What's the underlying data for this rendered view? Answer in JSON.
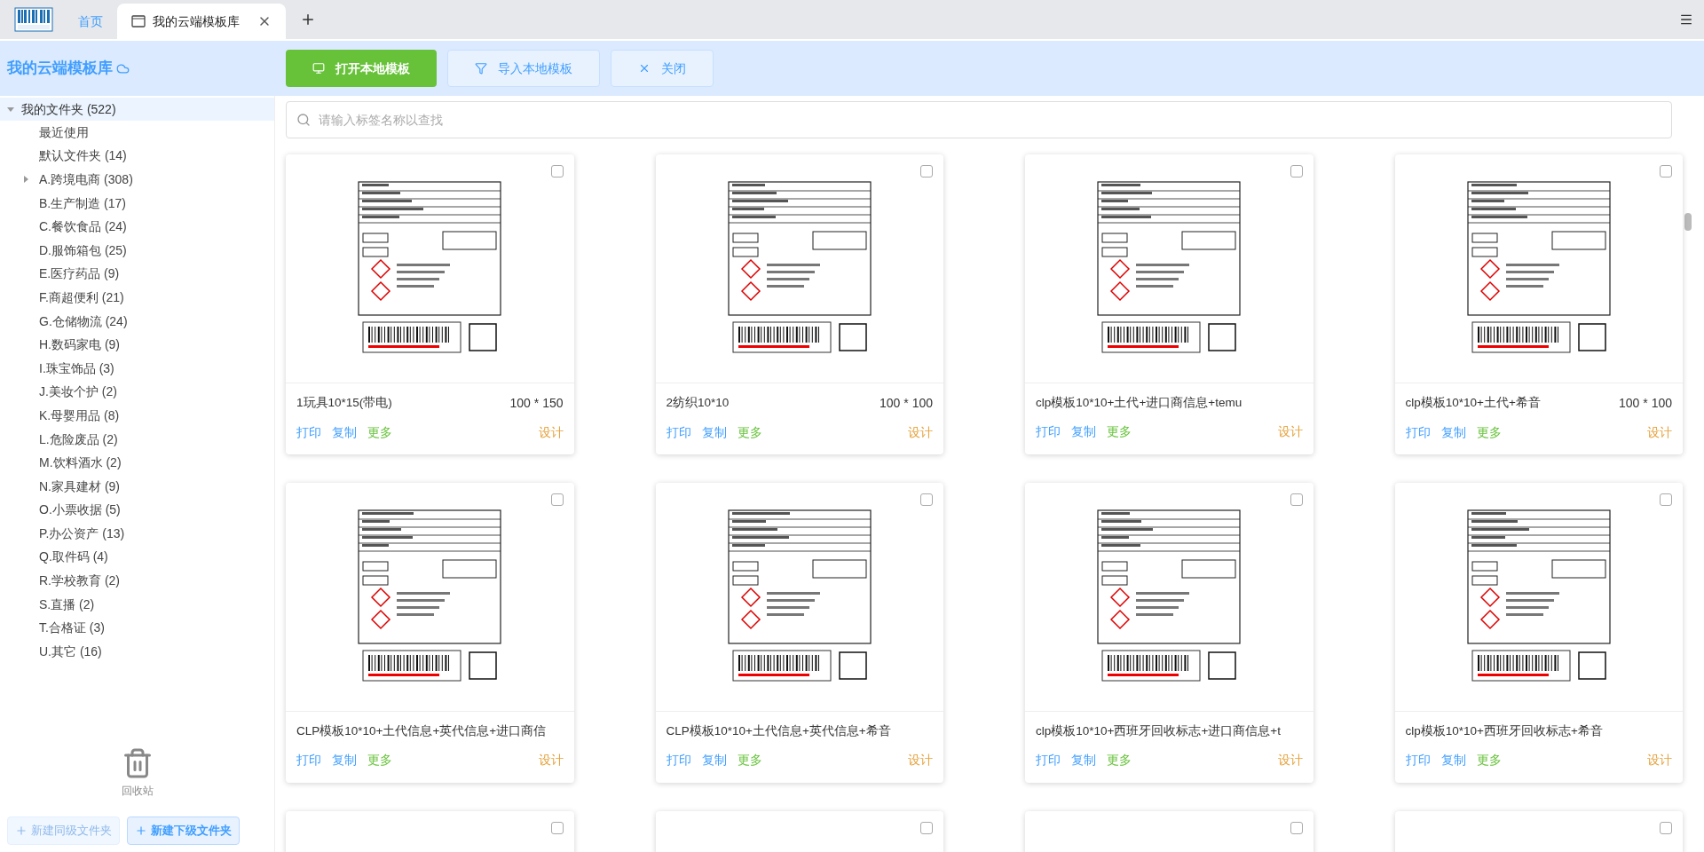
{
  "tabs": [
    {
      "label": "首页",
      "selected": false,
      "closable": false
    },
    {
      "label": "我的云端模板库",
      "selected": true,
      "closable": true
    }
  ],
  "sidebar": {
    "title": "我的云端模板库",
    "tree": {
      "label": "我的文件夹 (522)",
      "selected": true,
      "expanded": true,
      "children": [
        {
          "label": "最近使用",
          "selected": false,
          "kind": "leaf"
        },
        {
          "label": "默认文件夹 (14)",
          "selected": false,
          "kind": "leaf"
        },
        {
          "label": "A.跨境电商 (308)",
          "selected": false,
          "kind": "collapsed"
        },
        {
          "label": "B.生产制造 (17)",
          "selected": false,
          "kind": "leaf"
        },
        {
          "label": "C.餐饮食品 (24)",
          "selected": false,
          "kind": "leaf"
        },
        {
          "label": "D.服饰箱包 (25)",
          "selected": false,
          "kind": "leaf"
        },
        {
          "label": "E.医疗药品 (9)",
          "selected": false,
          "kind": "leaf"
        },
        {
          "label": "F.商超便利 (21)",
          "selected": false,
          "kind": "leaf"
        },
        {
          "label": "G.仓储物流 (24)",
          "selected": false,
          "kind": "leaf"
        },
        {
          "label": "H.数码家电 (9)",
          "selected": false,
          "kind": "leaf"
        },
        {
          "label": "I.珠宝饰品 (3)",
          "selected": false,
          "kind": "leaf"
        },
        {
          "label": "J.美妆个护 (2)",
          "selected": false,
          "kind": "leaf"
        },
        {
          "label": "K.母婴用品 (8)",
          "selected": false,
          "kind": "leaf"
        },
        {
          "label": "L.危险废品 (2)",
          "selected": false,
          "kind": "leaf"
        },
        {
          "label": "M.饮料酒水 (2)",
          "selected": false,
          "kind": "leaf"
        },
        {
          "label": "N.家具建材 (9)",
          "selected": false,
          "kind": "leaf"
        },
        {
          "label": "O.小票收据 (5)",
          "selected": false,
          "kind": "leaf"
        },
        {
          "label": "P.办公资产 (13)",
          "selected": false,
          "kind": "leaf"
        },
        {
          "label": "Q.取件码 (4)",
          "selected": false,
          "kind": "leaf"
        },
        {
          "label": "R.学校教育 (2)",
          "selected": false,
          "kind": "leaf"
        },
        {
          "label": "S.直播 (2)",
          "selected": false,
          "kind": "leaf"
        },
        {
          "label": "T.合格证 (3)",
          "selected": false,
          "kind": "leaf"
        },
        {
          "label": "U.其它 (16)",
          "selected": false,
          "kind": "leaf"
        }
      ]
    },
    "trash": "回收站",
    "buttons": [
      {
        "label": "新建同级文件夹",
        "disabled": true
      },
      {
        "label": "新建下级文件夹",
        "disabled": false
      }
    ]
  },
  "toolbar": [
    {
      "label": "打开本地模板",
      "kind": "primary"
    },
    {
      "label": "导入本地模板",
      "kind": "import"
    },
    {
      "label": "关闭",
      "kind": "close"
    }
  ],
  "search": {
    "placeholder": "请输入标签名称以查找"
  },
  "cards": [
    {
      "title": "1玩具10*15(带电)",
      "size": "100 * 150",
      "checked": false,
      "actions": [
        "打印",
        "复制",
        "更多"
      ],
      "design": "设计"
    },
    {
      "title": "2纺织10*10",
      "size": "100 * 100",
      "checked": false,
      "actions": [
        "打印",
        "复制",
        "更多"
      ],
      "design": "设计"
    },
    {
      "title": "clp模板10*10+土代+进口商信息+temu",
      "checked": false,
      "actions": [
        "打印",
        "复制",
        "更多"
      ],
      "design": "设计"
    },
    {
      "title": "clp模板10*10+土代+希音",
      "size": "100 * 100",
      "checked": false,
      "actions": [
        "打印",
        "复制",
        "更多"
      ],
      "design": "设计"
    },
    {
      "title": "CLP模板10*10+土代信息+英代信息+进口商信",
      "checked": false,
      "actions": [
        "打印",
        "复制",
        "更多"
      ],
      "design": "设计"
    },
    {
      "title": "CLP模板10*10+土代信息+英代信息+希音",
      "checked": false,
      "actions": [
        "打印",
        "复制",
        "更多"
      ],
      "design": "设计"
    },
    {
      "title": "clp模板10*10+西班牙回收标志+进口商信息+t",
      "checked": false,
      "actions": [
        "打印",
        "复制",
        "更多"
      ],
      "design": "设计"
    },
    {
      "title": "clp模板10*10+西班牙回收标志+希音",
      "checked": false,
      "actions": [
        "打印",
        "复制",
        "更多"
      ],
      "design": "设计"
    }
  ],
  "partial_cards": [
    {
      "checked": false
    },
    {
      "checked": false
    },
    {
      "checked": false
    },
    {
      "checked": false
    }
  ]
}
